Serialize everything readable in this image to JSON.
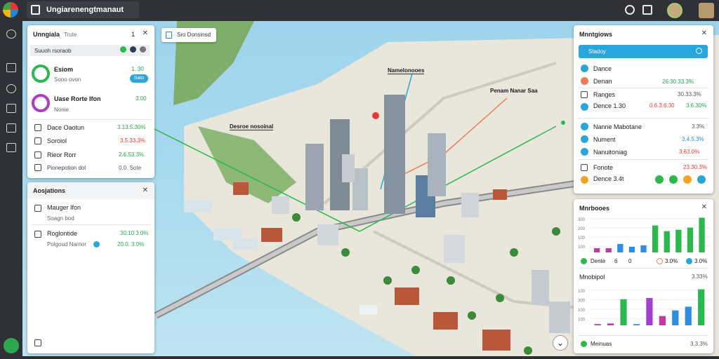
{
  "app": {
    "title": "Ungiarenengtmanaut"
  },
  "left_panel": {
    "title": "Unngiala",
    "subtitle": "Trute",
    "count": "1",
    "filter_label": "Suuoh rsoraob",
    "items": [
      {
        "label": "Esiom",
        "sub": "Sooo ovon",
        "value": "1. 30",
        "badge": "Sato"
      },
      {
        "label": "Uase Rorte Ifon",
        "sub": "Nonie",
        "value": "3.00"
      }
    ],
    "stats": [
      {
        "label": "Dace Oaotun",
        "value": "3.13.5.30%"
      },
      {
        "label": "Soroiol",
        "value": "3.5.33.3%"
      },
      {
        "label": "Rieor Rorr",
        "value": "2.6.53.3%"
      },
      {
        "label": "Pionepotion dol",
        "value": "0.0. Sote"
      }
    ]
  },
  "left_panel2": {
    "title": "Aosjations",
    "items": [
      {
        "label": "Mauger Ifon",
        "sub": "Soagn bod",
        "value": ""
      },
      {
        "label": "Roglontide",
        "sub": "Polgoud Narnor",
        "value": "30.10 3.0%",
        "value2": "20.0. 3.0%"
      }
    ]
  },
  "map": {
    "search_label": "Sro Donsinsd",
    "labels": [
      {
        "text": "Namelonooes"
      },
      {
        "text": "Penam Nanar Saa"
      },
      {
        "text": "Desroe nosoinal"
      }
    ]
  },
  "right_panel": {
    "title": "Mnntgiows",
    "button": "Stadoy",
    "rows": [
      {
        "label": "Dance",
        "value": ""
      },
      {
        "label": "Denan",
        "value": "26.30.33.3%"
      },
      {
        "label": "Ranges",
        "value": "30.33.3%"
      },
      {
        "label": "Dence 1.30",
        "value": "0.6.3.6.30",
        "value2": "3.6.30%"
      },
      {
        "label": "Nanne Mabotane",
        "value": "3.3%"
      },
      {
        "label": "Nument",
        "value": "3.4.5.3%"
      },
      {
        "label": "Nanuitoniag",
        "value": "3.63.0%"
      },
      {
        "label": "Fonote",
        "value": "23.30.3%"
      },
      {
        "label": "Dence 3.4t",
        "value": ""
      }
    ]
  },
  "chart_panel": {
    "title": "Mnrbooes",
    "legend": [
      {
        "label": "Dente",
        "value": "6"
      },
      {
        "label": "",
        "value": "0"
      },
      {
        "label": "",
        "value": "3.0%"
      },
      {
        "label": "",
        "value": "3.0%"
      }
    ],
    "section2": "Mnobipol",
    "section2_value": "3.33%",
    "footer_label": "Meinuas",
    "footer_value": "3.3.3%"
  },
  "chart_data": [
    {
      "type": "bar",
      "title": "Mnrbooes",
      "yticks": [
        "300",
        "200",
        "100",
        "100"
      ],
      "values": [
        6,
        6,
        12,
        8,
        10,
        38,
        30,
        32,
        35,
        49
      ],
      "colors": [
        "#c13aa4",
        "#c13aa4",
        "#2d8ee3",
        "#2d8ee3",
        "#2d8ee3",
        "#2db84f",
        "#2db84f",
        "#2db84f",
        "#2db84f",
        "#2db84f"
      ]
    },
    {
      "type": "bar",
      "title": "Mnobipol",
      "yticks": [
        "100",
        "300",
        "100",
        "100"
      ],
      "values": [
        2,
        3,
        42,
        2,
        44,
        15,
        24,
        30,
        58
      ],
      "colors": [
        "#c13aa4",
        "#c13aa4",
        "#2db84f",
        "#2d8ee3",
        "#a53fcf",
        "#c13aa4",
        "#2d8ee3",
        "#2d8ee3",
        "#2db84f"
      ]
    }
  ]
}
